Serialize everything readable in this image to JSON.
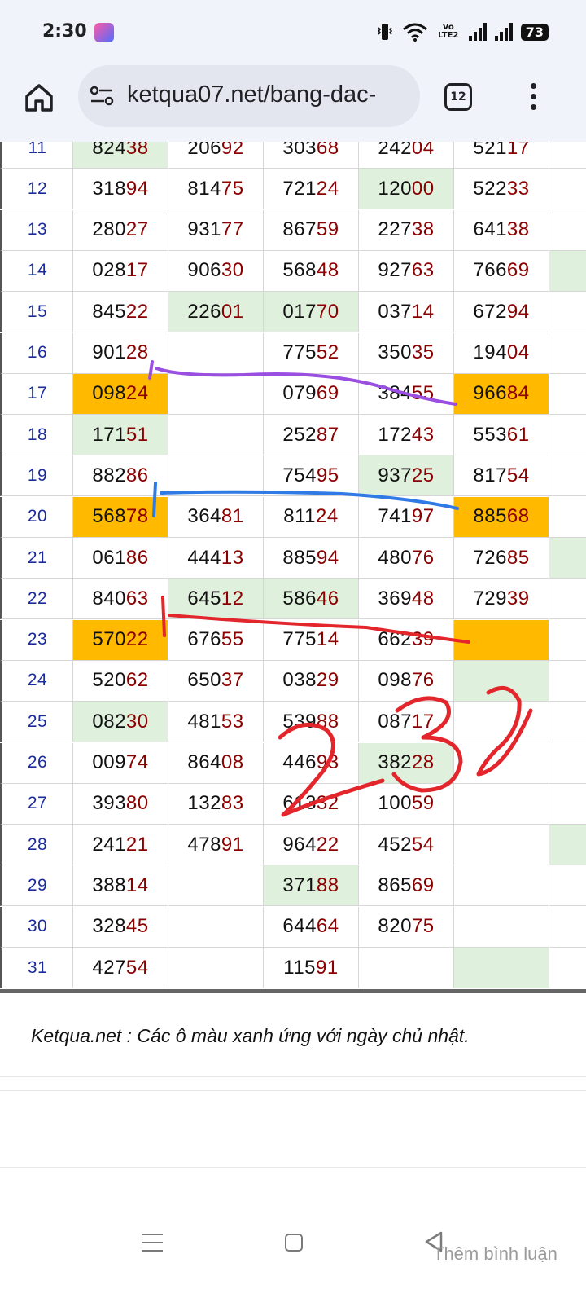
{
  "status": {
    "time": "2:30",
    "network": "Vo LTE2",
    "battery": "73"
  },
  "browser": {
    "url": "ketqua07.net/bang-dac-",
    "tab_count": "12"
  },
  "table": {
    "rows": [
      {
        "day": "11",
        "cells": [
          {
            "head": "824",
            "tail": "38",
            "hl": "green"
          },
          {
            "head": "206",
            "tail": "92",
            "hl": ""
          },
          {
            "head": "303",
            "tail": "68",
            "hl": ""
          },
          {
            "head": "242",
            "tail": "04",
            "hl": ""
          },
          {
            "head": "521",
            "tail": "17",
            "hl": ""
          },
          {
            "head": "",
            "tail": "",
            "hl": ""
          }
        ]
      },
      {
        "day": "12",
        "cells": [
          {
            "head": "318",
            "tail": "94",
            "hl": ""
          },
          {
            "head": "814",
            "tail": "75",
            "hl": ""
          },
          {
            "head": "721",
            "tail": "24",
            "hl": ""
          },
          {
            "head": "120",
            "tail": "00",
            "hl": "green"
          },
          {
            "head": "522",
            "tail": "33",
            "hl": ""
          },
          {
            "head": "",
            "tail": "",
            "hl": ""
          }
        ]
      },
      {
        "day": "13",
        "cells": [
          {
            "head": "280",
            "tail": "27",
            "hl": ""
          },
          {
            "head": "931",
            "tail": "77",
            "hl": ""
          },
          {
            "head": "867",
            "tail": "59",
            "hl": ""
          },
          {
            "head": "227",
            "tail": "38",
            "hl": ""
          },
          {
            "head": "641",
            "tail": "38",
            "hl": ""
          },
          {
            "head": "",
            "tail": "",
            "hl": ""
          }
        ]
      },
      {
        "day": "14",
        "cells": [
          {
            "head": "028",
            "tail": "17",
            "hl": ""
          },
          {
            "head": "906",
            "tail": "30",
            "hl": ""
          },
          {
            "head": "568",
            "tail": "48",
            "hl": ""
          },
          {
            "head": "927",
            "tail": "63",
            "hl": ""
          },
          {
            "head": "766",
            "tail": "69",
            "hl": ""
          },
          {
            "head": "",
            "tail": "",
            "hl": "green"
          }
        ]
      },
      {
        "day": "15",
        "cells": [
          {
            "head": "845",
            "tail": "22",
            "hl": ""
          },
          {
            "head": "226",
            "tail": "01",
            "hl": "green"
          },
          {
            "head": "017",
            "tail": "70",
            "hl": "green"
          },
          {
            "head": "037",
            "tail": "14",
            "hl": ""
          },
          {
            "head": "672",
            "tail": "94",
            "hl": ""
          },
          {
            "head": "",
            "tail": "",
            "hl": ""
          }
        ]
      },
      {
        "day": "16",
        "cells": [
          {
            "head": "901",
            "tail": "28",
            "hl": ""
          },
          {
            "head": "",
            "tail": "",
            "hl": ""
          },
          {
            "head": "775",
            "tail": "52",
            "hl": ""
          },
          {
            "head": "350",
            "tail": "35",
            "hl": ""
          },
          {
            "head": "194",
            "tail": "04",
            "hl": ""
          },
          {
            "head": "",
            "tail": "",
            "hl": ""
          }
        ]
      },
      {
        "day": "17",
        "cells": [
          {
            "head": "098",
            "tail": "24",
            "hl": "orange"
          },
          {
            "head": "",
            "tail": "",
            "hl": ""
          },
          {
            "head": "079",
            "tail": "69",
            "hl": ""
          },
          {
            "head": "384",
            "tail": "55",
            "hl": ""
          },
          {
            "head": "966",
            "tail": "84",
            "hl": "orange"
          },
          {
            "head": "",
            "tail": "",
            "hl": ""
          }
        ]
      },
      {
        "day": "18",
        "cells": [
          {
            "head": "171",
            "tail": "51",
            "hl": "green"
          },
          {
            "head": "",
            "tail": "",
            "hl": ""
          },
          {
            "head": "252",
            "tail": "87",
            "hl": ""
          },
          {
            "head": "172",
            "tail": "43",
            "hl": ""
          },
          {
            "head": "553",
            "tail": "61",
            "hl": ""
          },
          {
            "head": "",
            "tail": "",
            "hl": ""
          }
        ]
      },
      {
        "day": "19",
        "cells": [
          {
            "head": "882",
            "tail": "86",
            "hl": ""
          },
          {
            "head": "",
            "tail": "",
            "hl": ""
          },
          {
            "head": "754",
            "tail": "95",
            "hl": ""
          },
          {
            "head": "937",
            "tail": "25",
            "hl": "green"
          },
          {
            "head": "817",
            "tail": "54",
            "hl": ""
          },
          {
            "head": "",
            "tail": "",
            "hl": ""
          }
        ]
      },
      {
        "day": "20",
        "cells": [
          {
            "head": "568",
            "tail": "78",
            "hl": "orange"
          },
          {
            "head": "364",
            "tail": "81",
            "hl": ""
          },
          {
            "head": "811",
            "tail": "24",
            "hl": ""
          },
          {
            "head": "741",
            "tail": "97",
            "hl": ""
          },
          {
            "head": "885",
            "tail": "68",
            "hl": "orange"
          },
          {
            "head": "",
            "tail": "",
            "hl": ""
          }
        ]
      },
      {
        "day": "21",
        "cells": [
          {
            "head": "061",
            "tail": "86",
            "hl": ""
          },
          {
            "head": "444",
            "tail": "13",
            "hl": ""
          },
          {
            "head": "885",
            "tail": "94",
            "hl": ""
          },
          {
            "head": "480",
            "tail": "76",
            "hl": ""
          },
          {
            "head": "726",
            "tail": "85",
            "hl": ""
          },
          {
            "head": "",
            "tail": "",
            "hl": "green"
          }
        ]
      },
      {
        "day": "22",
        "cells": [
          {
            "head": "840",
            "tail": "63",
            "hl": ""
          },
          {
            "head": "645",
            "tail": "12",
            "hl": "green"
          },
          {
            "head": "586",
            "tail": "46",
            "hl": "green"
          },
          {
            "head": "369",
            "tail": "48",
            "hl": ""
          },
          {
            "head": "729",
            "tail": "39",
            "hl": ""
          },
          {
            "head": "",
            "tail": "",
            "hl": ""
          }
        ]
      },
      {
        "day": "23",
        "cells": [
          {
            "head": "570",
            "tail": "22",
            "hl": "orange"
          },
          {
            "head": "676",
            "tail": "55",
            "hl": ""
          },
          {
            "head": "775",
            "tail": "14",
            "hl": ""
          },
          {
            "head": "662",
            "tail": "39",
            "hl": ""
          },
          {
            "head": "",
            "tail": "",
            "hl": "orange"
          },
          {
            "head": "",
            "tail": "",
            "hl": ""
          }
        ]
      },
      {
        "day": "24",
        "cells": [
          {
            "head": "520",
            "tail": "62",
            "hl": ""
          },
          {
            "head": "650",
            "tail": "37",
            "hl": ""
          },
          {
            "head": "038",
            "tail": "29",
            "hl": ""
          },
          {
            "head": "098",
            "tail": "76",
            "hl": ""
          },
          {
            "head": "",
            "tail": "",
            "hl": "green"
          },
          {
            "head": "",
            "tail": "",
            "hl": ""
          }
        ]
      },
      {
        "day": "25",
        "cells": [
          {
            "head": "082",
            "tail": "30",
            "hl": "green"
          },
          {
            "head": "481",
            "tail": "53",
            "hl": ""
          },
          {
            "head": "539",
            "tail": "88",
            "hl": ""
          },
          {
            "head": "087",
            "tail": "17",
            "hl": ""
          },
          {
            "head": "",
            "tail": "",
            "hl": ""
          },
          {
            "head": "",
            "tail": "",
            "hl": ""
          }
        ]
      },
      {
        "day": "26",
        "cells": [
          {
            "head": "009",
            "tail": "74",
            "hl": ""
          },
          {
            "head": "864",
            "tail": "08",
            "hl": ""
          },
          {
            "head": "446",
            "tail": "93",
            "hl": ""
          },
          {
            "head": "382",
            "tail": "28",
            "hl": "green"
          },
          {
            "head": "",
            "tail": "",
            "hl": ""
          },
          {
            "head": "",
            "tail": "",
            "hl": ""
          }
        ]
      },
      {
        "day": "27",
        "cells": [
          {
            "head": "393",
            "tail": "80",
            "hl": ""
          },
          {
            "head": "132",
            "tail": "83",
            "hl": ""
          },
          {
            "head": "613",
            "tail": "32",
            "hl": ""
          },
          {
            "head": "100",
            "tail": "59",
            "hl": ""
          },
          {
            "head": "",
            "tail": "",
            "hl": ""
          },
          {
            "head": "",
            "tail": "",
            "hl": ""
          }
        ]
      },
      {
        "day": "28",
        "cells": [
          {
            "head": "241",
            "tail": "21",
            "hl": ""
          },
          {
            "head": "478",
            "tail": "91",
            "hl": ""
          },
          {
            "head": "964",
            "tail": "22",
            "hl": ""
          },
          {
            "head": "452",
            "tail": "54",
            "hl": ""
          },
          {
            "head": "",
            "tail": "",
            "hl": ""
          },
          {
            "head": "",
            "tail": "",
            "hl": "green"
          }
        ]
      },
      {
        "day": "29",
        "cells": [
          {
            "head": "388",
            "tail": "14",
            "hl": ""
          },
          {
            "head": "",
            "tail": "",
            "hl": ""
          },
          {
            "head": "371",
            "tail": "88",
            "hl": "green"
          },
          {
            "head": "865",
            "tail": "69",
            "hl": ""
          },
          {
            "head": "",
            "tail": "",
            "hl": ""
          },
          {
            "head": "",
            "tail": "",
            "hl": ""
          }
        ]
      },
      {
        "day": "30",
        "cells": [
          {
            "head": "328",
            "tail": "45",
            "hl": ""
          },
          {
            "head": "",
            "tail": "",
            "hl": ""
          },
          {
            "head": "644",
            "tail": "64",
            "hl": ""
          },
          {
            "head": "820",
            "tail": "75",
            "hl": ""
          },
          {
            "head": "",
            "tail": "",
            "hl": ""
          },
          {
            "head": "",
            "tail": "",
            "hl": ""
          }
        ]
      },
      {
        "day": "31",
        "cells": [
          {
            "head": "427",
            "tail": "54",
            "hl": ""
          },
          {
            "head": "",
            "tail": "",
            "hl": ""
          },
          {
            "head": "115",
            "tail": "91",
            "hl": ""
          },
          {
            "head": "",
            "tail": "",
            "hl": ""
          },
          {
            "head": "",
            "tail": "",
            "hl": "green"
          },
          {
            "head": "",
            "tail": "",
            "hl": ""
          }
        ]
      }
    ]
  },
  "note": "Ketqua.net : Các ô màu xanh ứng với ngày chủ nhật.",
  "comment_link": "Thêm bình luận",
  "annotations": {
    "handwritten_number": "232",
    "colors": {
      "purple": "#9b4fe0",
      "blue": "#2f7ae5",
      "red": "#e2262b"
    }
  },
  "colors": {
    "green": "#dff0dc",
    "orange": "#ffba00",
    "tail": "#8b0000",
    "day": "#1a2b9c"
  }
}
